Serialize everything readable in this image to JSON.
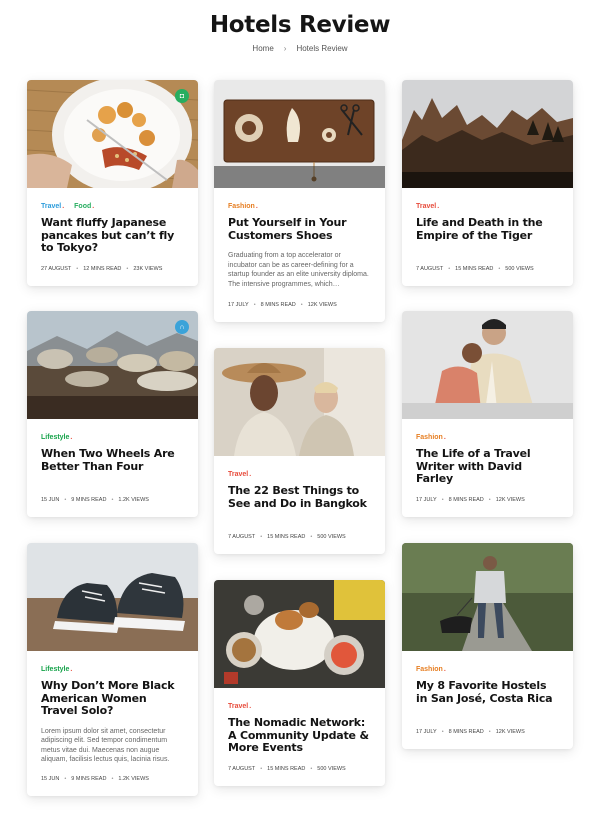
{
  "page": {
    "title": "Hotels Review"
  },
  "breadcrumb": {
    "home": "Home",
    "separator": "›",
    "current": "Hotels Review"
  },
  "colors": {
    "travel": "#2d9cdb",
    "food": "#27ae60",
    "fashion": "#e67e22",
    "lifestyle": "#16a34a",
    "travel_red": "#e74c3c",
    "badge_green": "#27ae60",
    "badge_blue": "#3ba3d9"
  },
  "cards": [
    {
      "categories": [
        "Travel",
        "Food"
      ],
      "title": "Want fluffy Japanese pancakes but can’t fly to Tokyo?",
      "excerpt": "",
      "date": "27 AUGUST",
      "read": "12 MINS READ",
      "views": "23K VIEWS",
      "badge_icon": "camera-icon"
    },
    {
      "categories": [
        "Fashion"
      ],
      "title": "Put Yourself in Your Customers Shoes",
      "excerpt": "Graduating from a top accelerator or incubator can be as career-defining for a startup founder as an elite university diploma. The intensive programmes, which…",
      "date": "17 JULY",
      "read": "8 MINS READ",
      "views": "12K VIEWS"
    },
    {
      "categories": [
        "Travel"
      ],
      "title": "Life and Death in the Empire of the Tiger",
      "excerpt": "",
      "date": "7 AUGUST",
      "read": "15 MINS READ",
      "views": "500 VIEWS"
    },
    {
      "categories": [
        "Lifestyle"
      ],
      "title": "When Two Wheels Are Better Than Four",
      "excerpt": "",
      "date": "15 JUN",
      "read": "9 MINS READ",
      "views": "1.2K VIEWS",
      "badge_icon": "headphones-icon"
    },
    {
      "categories": [
        "Travel"
      ],
      "title": "The 22 Best Things to See and Do in Bangkok",
      "excerpt": "",
      "date": "7 AUGUST",
      "read": "15 MINS READ",
      "views": "500 VIEWS"
    },
    {
      "categories": [
        "Fashion"
      ],
      "title": "The Life of a Travel Writer with David Farley",
      "excerpt": "",
      "date": "17 JULY",
      "read": "8 MINS READ",
      "views": "12K VIEWS"
    },
    {
      "categories": [
        "Lifestyle"
      ],
      "title": "Why Don’t More Black American Women Travel Solo?",
      "excerpt": "Lorem ipsum dolor sit amet, consectetur adipiscing elit. Sed tempor condimentum metus vitae dui. Maecenas non augue aliquam, facilisis lectus quis, lacinia risus.",
      "date": "15 JUN",
      "read": "9 MINS READ",
      "views": "1.2K VIEWS"
    },
    {
      "categories": [
        "Travel"
      ],
      "title": "The Nomadic Network: A Community Update & More Events",
      "excerpt": "",
      "date": "7 AUGUST",
      "read": "15 MINS READ",
      "views": "500 VIEWS"
    },
    {
      "categories": [
        "Fashion"
      ],
      "title": "My 8 Favorite Hostels in San José, Costa Rica",
      "excerpt": "",
      "date": "17 JULY",
      "read": "8 MINS READ",
      "views": "12K VIEWS"
    }
  ]
}
